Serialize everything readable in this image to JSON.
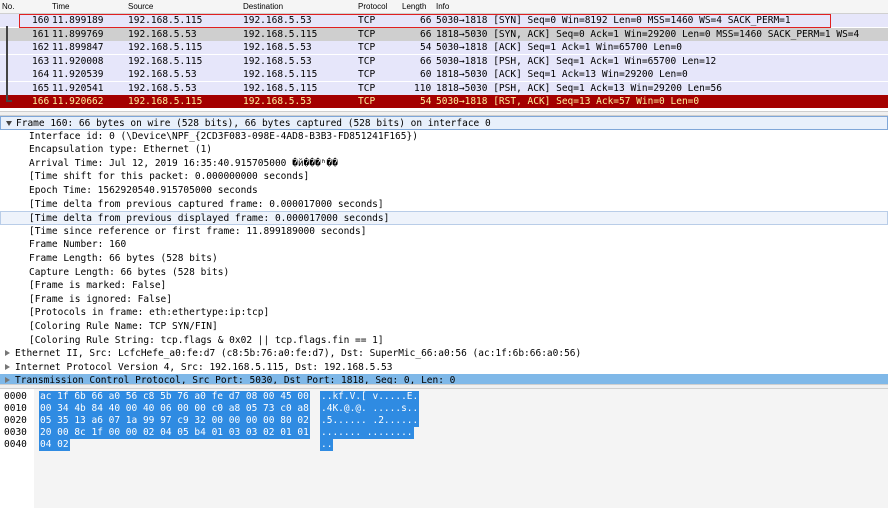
{
  "packet_list": {
    "columns": [
      "No.",
      "Time",
      "Source",
      "Destination",
      "Protocol",
      "Length",
      "Info"
    ],
    "rows": [
      {
        "no": "160",
        "time": "11.899189",
        "src": "192.168.5.115",
        "dst": "192.168.5.53",
        "proto": "TCP",
        "len": "66",
        "info": "5030→1818 [SYN] Seq=0 Win=8192 Len=0 MSS=1460 WS=4 SACK_PERM=1",
        "style": "light"
      },
      {
        "no": "161",
        "time": "11.899769",
        "src": "192.168.5.53",
        "dst": "192.168.5.115",
        "proto": "TCP",
        "len": "66",
        "info": "1818→5030 [SYN, ACK] Seq=0 Ack=1 Win=29200 Len=0 MSS=1460 SACK_PERM=1 WS=4",
        "style": "sel"
      },
      {
        "no": "162",
        "time": "11.899847",
        "src": "192.168.5.115",
        "dst": "192.168.5.53",
        "proto": "TCP",
        "len": "54",
        "info": "5030→1818 [ACK] Seq=1 Ack=1 Win=65700 Len=0",
        "style": "light"
      },
      {
        "no": "163",
        "time": "11.920008",
        "src": "192.168.5.115",
        "dst": "192.168.5.53",
        "proto": "TCP",
        "len": "66",
        "info": "5030→1818 [PSH, ACK] Seq=1 Ack=1 Win=65700 Len=12",
        "style": "light"
      },
      {
        "no": "164",
        "time": "11.920539",
        "src": "192.168.5.53",
        "dst": "192.168.5.115",
        "proto": "TCP",
        "len": "60",
        "info": "1818→5030 [ACK] Seq=1 Ack=13 Win=29200 Len=0",
        "style": "light"
      },
      {
        "no": "165",
        "time": "11.920541",
        "src": "192.168.5.53",
        "dst": "192.168.5.115",
        "proto": "TCP",
        "len": "110",
        "info": "1818→5030 [PSH, ACK] Seq=1 Ack=13 Win=29200 Len=56",
        "style": "light"
      },
      {
        "no": "166",
        "time": "11.920662",
        "src": "192.168.5.115",
        "dst": "192.168.5.53",
        "proto": "TCP",
        "len": "54",
        "info": "5030→1818 [RST, ACK] Seq=13 Ack=57 Win=0 Len=0",
        "style": "rst"
      }
    ]
  },
  "details": {
    "frame_summary": "Frame 160: 66 bytes on wire (528 bits), 66 bytes captured (528 bits) on interface 0",
    "frame_fields": [
      "Interface id: 0 (\\Device\\NPF_{2CD3F083-098E-4AD8-B3B3-FD851241F165})",
      "Encapsulation type: Ethernet (1)",
      "Arrival Time: Jul 12, 2019 16:35:40.915705000 �й���ʱ��",
      "[Time shift for this packet: 0.000000000 seconds]",
      "Epoch Time: 1562920540.915705000 seconds",
      "[Time delta from previous captured frame: 0.000017000 seconds]",
      "[Time delta from previous displayed frame: 0.000017000 seconds]",
      "[Time since reference or first frame: 11.899189000 seconds]",
      "Frame Number: 160",
      "Frame Length: 66 bytes (528 bits)",
      "Capture Length: 66 bytes (528 bits)",
      "[Frame is marked: False]",
      "[Frame is ignored: False]",
      "[Protocols in frame: eth:ethertype:ip:tcp]",
      "[Coloring Rule Name: TCP SYN/FIN]",
      "[Coloring Rule String: tcp.flags & 0x02 || tcp.flags.fin == 1]"
    ],
    "ethernet": "Ethernet II, Src: LcfcHefe_a0:fe:d7 (c8:5b:76:a0:fe:d7), Dst: SuperMic_66:a0:56 (ac:1f:6b:66:a0:56)",
    "ip": "Internet Protocol Version 4, Src: 192.168.5.115, Dst: 192.168.5.53",
    "tcp": "Transmission Control Protocol, Src Port: 5030, Dst Port: 1818, Seq: 0, Len: 0"
  },
  "bytes": [
    {
      "offset": "0000",
      "hex": "ac 1f 6b 66 a0 56 c8 5b  76 a0 fe d7 08 00 45 00",
      "ascii": "..kf.V.[ v.....E."
    },
    {
      "offset": "0010",
      "hex": "00 34 4b 84 40 00 40 06  00 00 c0 a8 05 73 c0 a8",
      "ascii": ".4K.@.@. .....s.."
    },
    {
      "offset": "0020",
      "hex": "05 35 13 a6 07 1a 99 97  c9 32 00 00 00 00 80 02",
      "ascii": ".5...... .2......"
    },
    {
      "offset": "0030",
      "hex": "20 00 8c 1f 00 00 02 04  05 b4 01 03 03 02 01 01",
      "ascii": " ....... ........"
    },
    {
      "offset": "0040",
      "hex": "04 02",
      "ascii": ".."
    }
  ],
  "colors": {
    "row_light": "#e6e6fa",
    "row_selected": "#cfcfcf",
    "row_rst_bg": "#a40000",
    "row_rst_fg": "#fff4a0",
    "bytes_highlight": "#2f8be2"
  }
}
